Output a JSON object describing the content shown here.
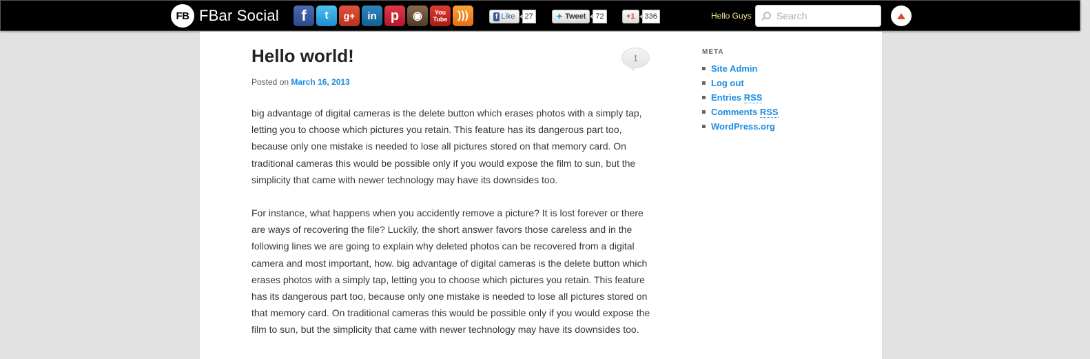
{
  "topbar": {
    "brand_logo": "FB",
    "brand_name": "FBar Social",
    "social_icons": [
      {
        "name": "facebook-icon",
        "glyph": "f"
      },
      {
        "name": "twitter-icon",
        "glyph": "t"
      },
      {
        "name": "google-plus-icon",
        "glyph": "g+"
      },
      {
        "name": "linkedin-icon",
        "glyph": "in"
      },
      {
        "name": "pinterest-icon",
        "glyph": "p"
      },
      {
        "name": "instagram-icon",
        "glyph": "◉"
      },
      {
        "name": "youtube-icon",
        "glyph": "You Tube"
      },
      {
        "name": "rss-icon",
        "glyph": ")))"
      }
    ],
    "fb_like": {
      "badge": "f",
      "label": "Like",
      "count": "27"
    },
    "tweet": {
      "label": "Tweet",
      "count": "72"
    },
    "gplus": {
      "label": "+1",
      "count": "336"
    },
    "greeting": "Hello Guys",
    "search_placeholder": "Search"
  },
  "post": {
    "title": "Hello world!",
    "comment_count": "1",
    "posted_on_label": "Posted on",
    "date": "March 16, 2013",
    "paragraph1": "big advantage of digital cameras is the delete button which erases photos with a simply tap, letting you to choose which pictures you retain. This feature has its dangerous part too, because only one mistake is needed to lose all pictures stored on that memory card. On traditional cameras this would be possible only if you would expose the film to sun, but the simplicity that came with newer technology may have its downsides too.",
    "paragraph2": "For instance, what happens when you accidently remove a picture? It is lost forever or there are ways of recovering the file? Luckily, the short answer favors those careless and in the following lines we are going to explain why deleted photos can be recovered from a digital camera and most important, how. big advantage of digital cameras is the delete button which erases photos with a simply tap, letting you to choose which pictures you retain. This feature has its dangerous part too, because only one mistake is needed to lose all pictures stored on that memory card. On traditional cameras this would be possible only if you would expose the film to sun, but the simplicity that came with newer technology may have its downsides too."
  },
  "sidebar": {
    "meta_title": "META",
    "links": {
      "site_admin": "Site Admin",
      "log_out": "Log out",
      "entries": "Entries",
      "comments": "Comments",
      "rss": "RSS",
      "wordpress": "WordPress.org"
    }
  },
  "colors": {
    "accent_link": "#1b8be0",
    "topbar_bg": "#000000",
    "greeting": "#f3e58d"
  }
}
